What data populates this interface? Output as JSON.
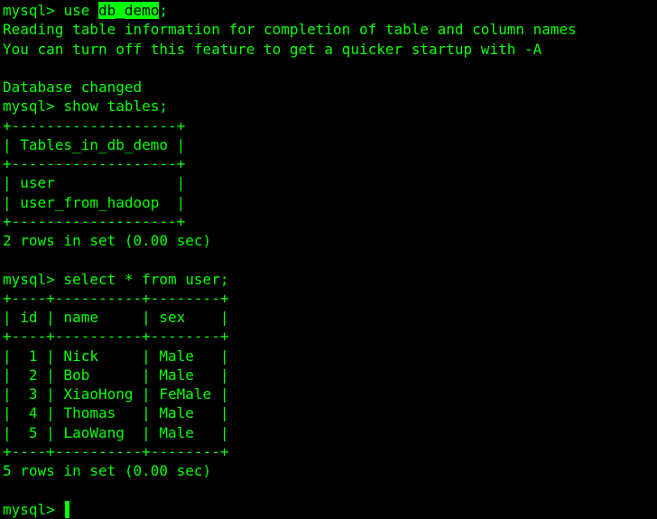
{
  "terminal": {
    "colors": {
      "background": "#000000",
      "text": "#00ff00"
    },
    "use_cmd": {
      "prompt": "mysql> ",
      "command": "use ",
      "db_name": "db_demo",
      "semicolon": ";"
    },
    "lines": [
      "Reading table information for completion of table and column names",
      "You can turn off this feature to get a quicker startup with -A",
      "",
      "Database changed",
      "mysql> show tables;",
      "+-------------------+",
      "| Tables_in_db_demo |",
      "+-------------------+",
      "| user              |",
      "| user_from_hadoop  |",
      "+-------------------+",
      "2 rows in set (0.00 sec)",
      "",
      "mysql> select * from user;",
      "+----+----------+--------+",
      "| id | name     | sex    |",
      "+----+----------+--------+",
      "|  1 | Nick     | Male   |",
      "|  2 | Bob      | Male   |",
      "|  3 | XiaoHong | FeMale |",
      "|  4 | Thomas   | Male   |",
      "|  5 | LaoWang  | Male   |",
      "+----+----------+--------+",
      "5 rows in set (0.00 sec)",
      ""
    ],
    "final_prompt": "mysql> "
  }
}
